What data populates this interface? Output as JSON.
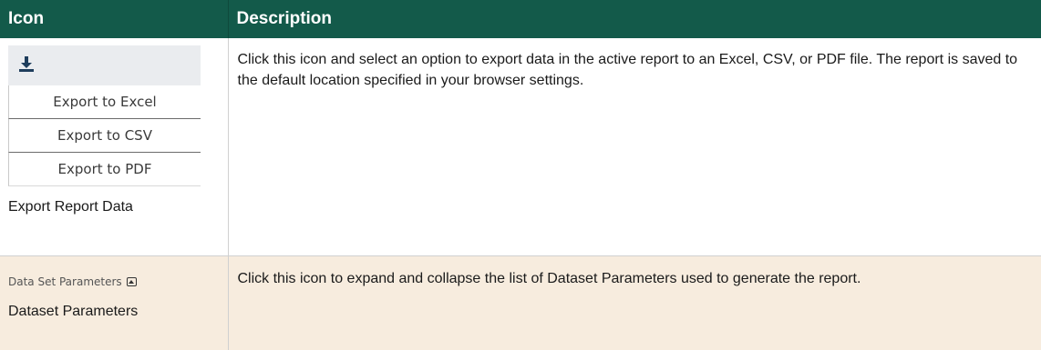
{
  "header": {
    "col_icon": "Icon",
    "col_description": "Description"
  },
  "rows": [
    {
      "icon_name": "download-icon",
      "menu_options": [
        "Export to Excel",
        "Export to CSV",
        "Export to PDF"
      ],
      "label": "Export Report Data",
      "description": "Click this icon and select an option to export data in the active report to an Excel, CSV, or PDF file. The report is saved to the default location specified in your browser settings."
    },
    {
      "toggle_text": "Data Set Parameters",
      "icon_name": "collapse-icon",
      "label": "Dataset Parameters",
      "description": "Click this icon to expand and collapse the list of Dataset Parameters used to generate the report."
    }
  ],
  "colors": {
    "header_bg": "#135a4a",
    "row2_bg": "#f7ecde",
    "icon_blue": "#1e3d5c"
  }
}
